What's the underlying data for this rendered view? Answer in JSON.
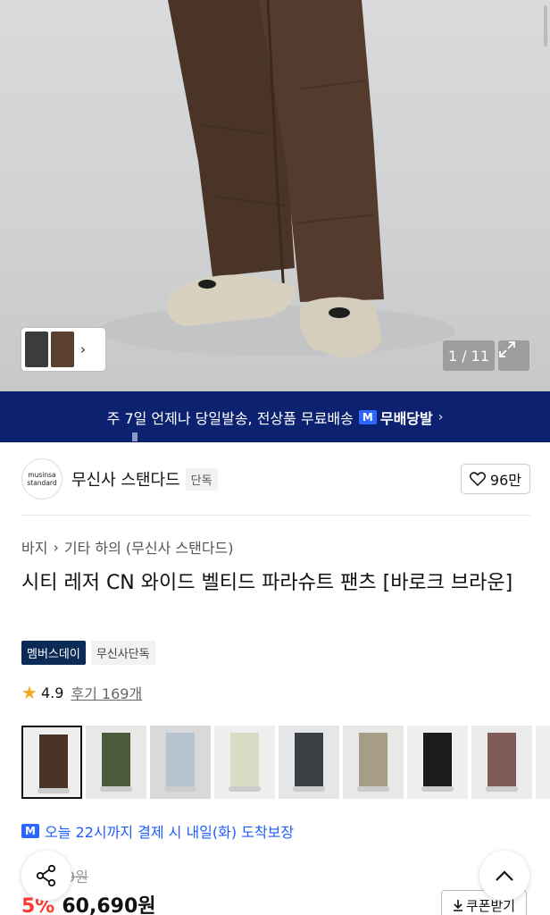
{
  "hero": {
    "counter": "1 / 11",
    "image_alt": "wide-leg brown parachute pants with beige sneakers"
  },
  "banner": {
    "text": "주 7일 언제나 당일발송, 전상품 무료배송",
    "badge_icon": "M",
    "badge_label": "무배당발",
    "chevron": "›"
  },
  "brand": {
    "logo_line1": "musinsa",
    "logo_line2": "standard",
    "name": "무신사 스탠다드",
    "tag": "단독",
    "likes": "96만"
  },
  "breadcrumb": {
    "category": "바지",
    "separator": "›",
    "subcategory": "기타 하의 (무신사 스탠다드)"
  },
  "product": {
    "title": "시티 레저 CN 와이드 벨티드 파라슈트 팬츠 [바로크 브라운]",
    "chips": [
      "멤버스데이",
      "무신사단독"
    ],
    "rating": "4.9",
    "reviews": "후기 169개"
  },
  "swatches": [
    {
      "name": "brown",
      "pants": "#4a3326",
      "bg": "#efefef"
    },
    {
      "name": "olive",
      "pants": "#4b5a3a",
      "bg": "#e8e8e6"
    },
    {
      "name": "light-blue",
      "pants": "#b7c3cf",
      "bg": "#d9d9d9"
    },
    {
      "name": "cream",
      "pants": "#d9dbc4",
      "bg": "#efefef"
    },
    {
      "name": "charcoal",
      "pants": "#3c3f44",
      "bg": "#e5e6e8"
    },
    {
      "name": "khaki",
      "pants": "#a79c85",
      "bg": "#e8e8e6"
    },
    {
      "name": "black",
      "pants": "#1b1b1b",
      "bg": "#efefef"
    },
    {
      "name": "mauve",
      "pants": "#7f5a57",
      "bg": "#ebebeb"
    },
    {
      "name": "partial",
      "pants": "#c9c9c9",
      "bg": "#efefef"
    }
  ],
  "delivery": {
    "icon": "M",
    "text": "오늘 22시까지 결제 시 내일(화) 도착보장"
  },
  "price": {
    "original": "9원",
    "discount": "5%",
    "current": "60,690원",
    "coupon_label": "쿠폰받기"
  },
  "colors": {
    "banner_bg": "#0c2271",
    "accent_blue": "#2a66ff",
    "discount_red": "#ff3b30",
    "star": "#f5a623"
  }
}
